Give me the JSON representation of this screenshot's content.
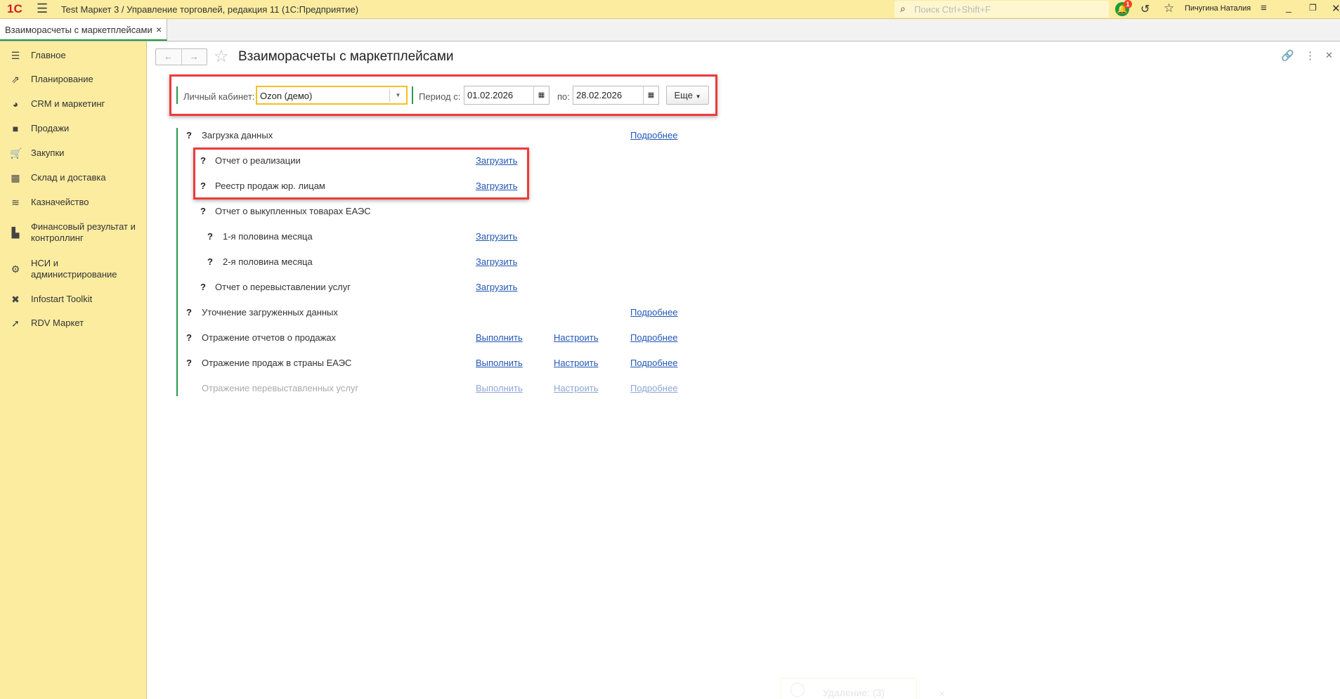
{
  "app": {
    "logo": "1С",
    "title": "Test Маркет 3 / Управление торговлей, редакция 11  (1С:Предприятие)",
    "search_placeholder": "Поиск Ctrl+Shift+F",
    "notification_count": "1",
    "user": "Пичугина Наталия"
  },
  "tab": {
    "label": "Взаиморасчеты с маркетплейсами",
    "close": "×"
  },
  "sidebar": {
    "items": [
      {
        "label": "Главное",
        "icon": "menu-icon"
      },
      {
        "label": "Планирование",
        "icon": "planning-icon"
      },
      {
        "label": "CRM и маркетинг",
        "icon": "pie-chart-icon"
      },
      {
        "label": "Продажи",
        "icon": "shopping-bag-icon"
      },
      {
        "label": "Закупки",
        "icon": "cart-icon"
      },
      {
        "label": "Склад и доставка",
        "icon": "warehouse-icon"
      },
      {
        "label": "Казначейство",
        "icon": "coins-icon"
      },
      {
        "label": "Финансовый результат и контроллинг",
        "icon": "bar-chart-icon"
      },
      {
        "label": "НСИ и администрирование",
        "icon": "gear-icon"
      },
      {
        "label": "Infostart Toolkit",
        "icon": "tools-icon"
      },
      {
        "label": "RDV Маркет",
        "icon": "rocket-icon"
      }
    ]
  },
  "form": {
    "title": "Взаиморасчеты с маркетплейсами",
    "cabinet_label": "Личный кабинет:",
    "cabinet_value": "Ozon (демо)",
    "period_from_label": "Период с:",
    "period_from": "01.02.2026",
    "period_to_label": "по:",
    "period_to": "28.02.2026",
    "more_button": "Еще"
  },
  "steps": [
    {
      "q": "?",
      "label": "Загрузка данных",
      "details": "Подробнее"
    },
    {
      "q": "?",
      "label": "Отчет о реализации",
      "action": "Загрузить"
    },
    {
      "q": "?",
      "label": "Реестр продаж юр. лицам",
      "action": "Загрузить"
    },
    {
      "q": "?",
      "label": "Отчет о выкупленных товарах ЕАЭС"
    },
    {
      "q": "?",
      "label": "1-я половина месяца",
      "action": "Загрузить"
    },
    {
      "q": "?",
      "label": "2-я половина месяца",
      "action": "Загрузить"
    },
    {
      "q": "?",
      "label": "Отчет о перевыставлении услуг",
      "action": "Загрузить"
    },
    {
      "q": "?",
      "label": "Уточнение загруженных данных",
      "details": "Подробнее"
    },
    {
      "q": "?",
      "label": "Отражение отчетов о продажах",
      "action": "Выполнить",
      "setup": "Настроить",
      "details": "Подробнее"
    },
    {
      "q": "?",
      "label": "Отражение продаж в страны ЕАЭС",
      "action": "Выполнить",
      "setup": "Настроить",
      "details": "Подробнее"
    },
    {
      "label": "Отражение перевыставленных услуг",
      "action": "Выполнить",
      "setup": "Настроить",
      "details": "Подробнее"
    }
  ],
  "toast": {
    "text": "Удаление: (3)",
    "close": "×"
  },
  "colors": {
    "accent": "#fbeca0",
    "green": "#2a9a4a",
    "red": "#ee3b3b",
    "link": "#2157b6"
  }
}
